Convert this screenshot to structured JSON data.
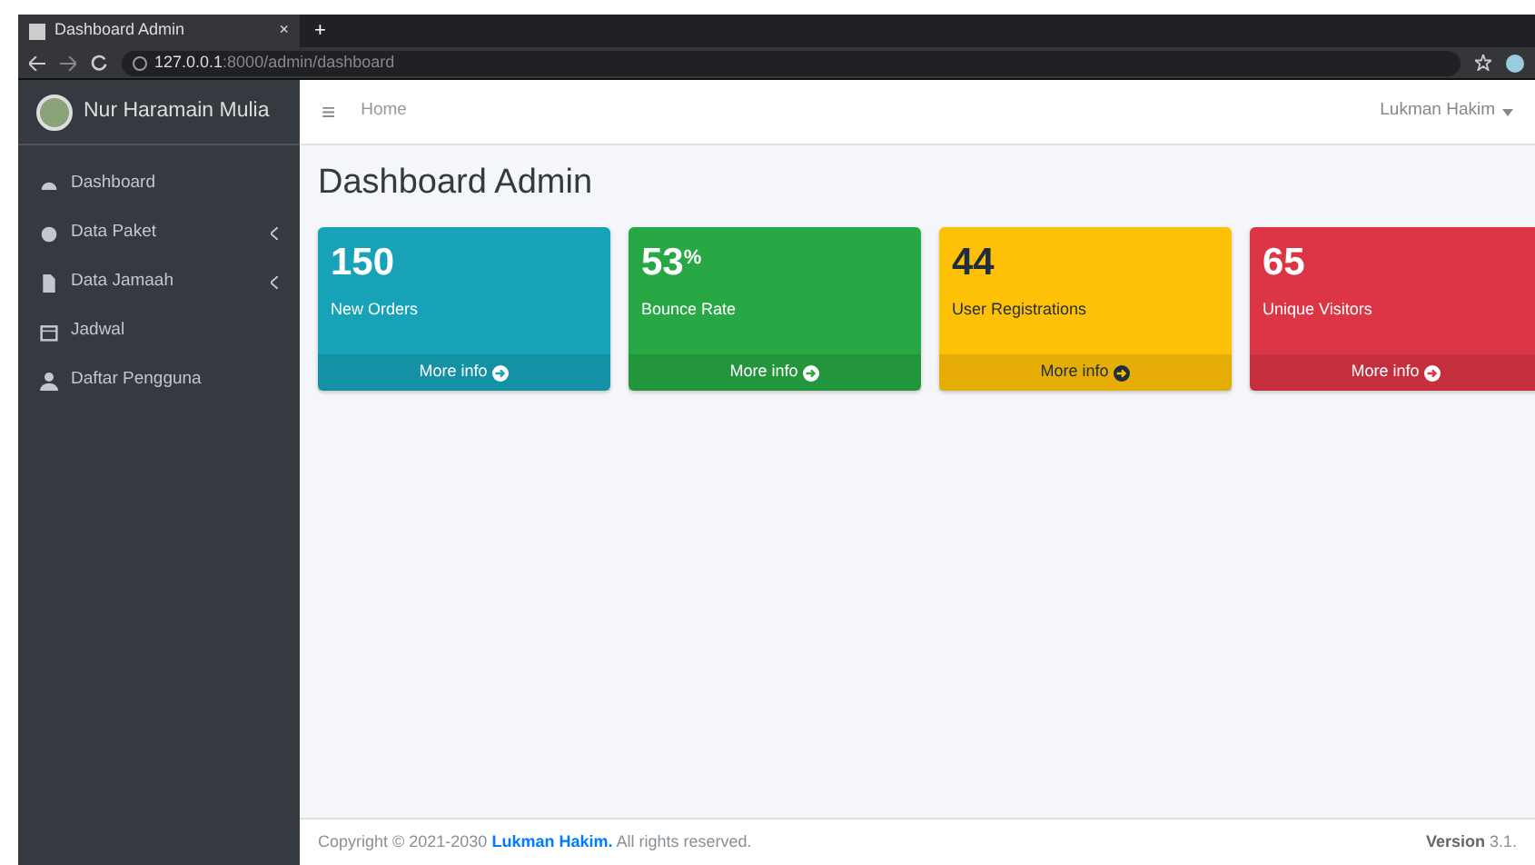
{
  "browser": {
    "tab_title": "Dashboard Admin",
    "tab_close": "×",
    "new_tab": "+",
    "url_host": "127.0.0.1",
    "url_path": ":8000/admin/dashboard"
  },
  "sidebar": {
    "brand": "Nur Haramain Mulia",
    "items": [
      {
        "label": "Dashboard",
        "kind": "dashboard",
        "has_children": false
      },
      {
        "label": "Data Paket",
        "kind": "box",
        "has_children": true
      },
      {
        "label": "Data Jamaah",
        "kind": "file",
        "has_children": true
      },
      {
        "label": "Jadwal",
        "kind": "calendar",
        "has_children": false
      },
      {
        "label": "Daftar Pengguna",
        "kind": "user",
        "has_children": false
      }
    ]
  },
  "navbar": {
    "menu_icon": "≡",
    "breadcrumb": "Home",
    "user": "Lukman Hakim"
  },
  "page_title": "Dashboard Admin",
  "cards": [
    {
      "value": "150",
      "label": "New Orders",
      "link": "More info",
      "kind": "info"
    },
    {
      "value": "53$^{%}$",
      "label": "Bounce Rate",
      "link": "More info",
      "kind": "success"
    },
    {
      "value": "44",
      "label": "User Registrations",
      "link": "More info",
      "kind": "warning"
    },
    {
      "value": "65",
      "label": "Unique Visitors",
      "link": "More info",
      "kind": "danger"
    }
  ],
  "footer": {
    "copyright": "Copyright © 2021-2030 **Lukman Hakim.** All rights reserved.",
    "version_label": "Version",
    "version": "3.1."
  }
}
